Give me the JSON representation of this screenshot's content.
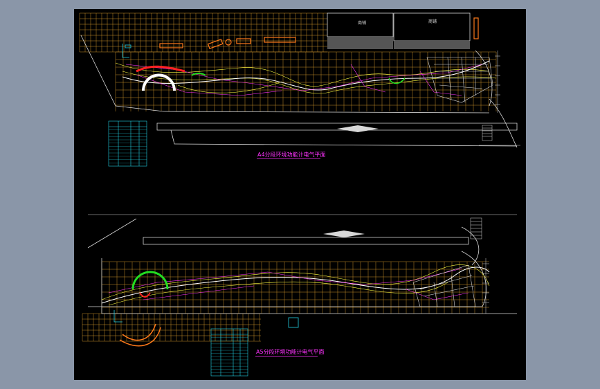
{
  "colors": {
    "desktop": "#8a96a8",
    "sheet": "#000000",
    "grid": "#c8902a",
    "outline": "#d8d8d8",
    "path": "#ffff44",
    "circuit": "#ff33ff",
    "cyan": "#22d3e6",
    "green": "#22dd22",
    "orange": "#ff7a1a",
    "red": "#ff2222"
  },
  "plans": {
    "upper": {
      "title": "A4分段环境功能计电气平面",
      "building_label_1": "商铺",
      "building_label_2": "商铺"
    },
    "lower": {
      "title": "A5分段环境功能计电气平面"
    }
  }
}
